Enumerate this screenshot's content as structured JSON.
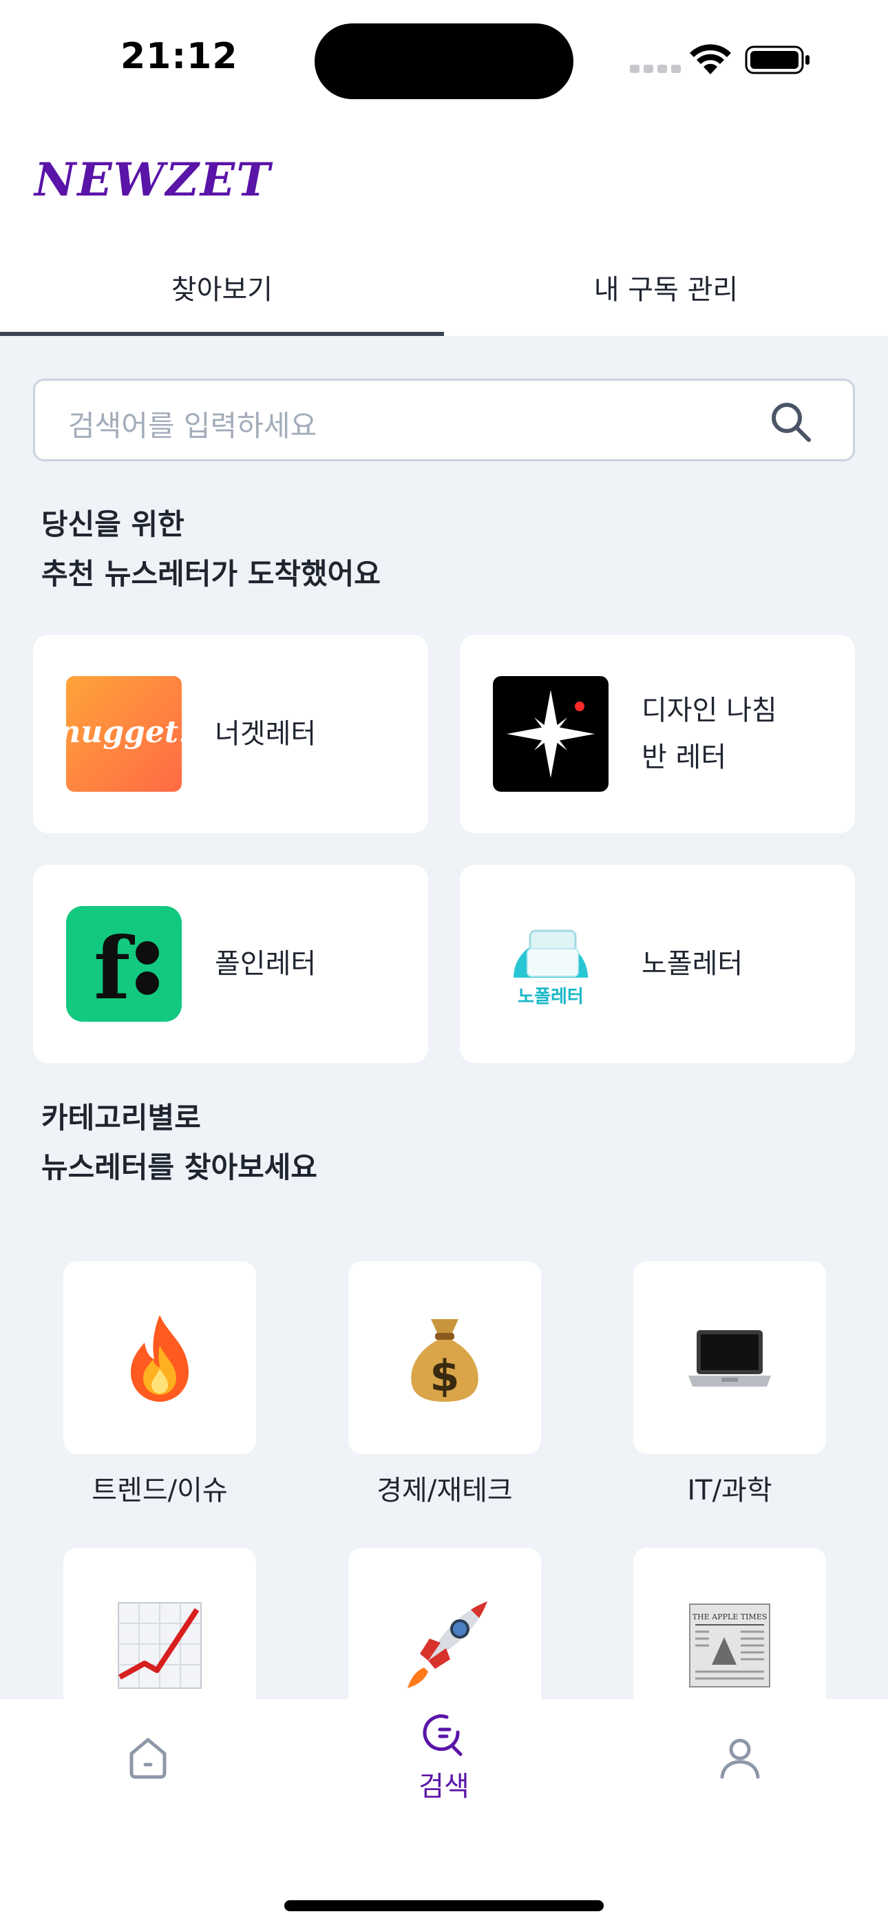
{
  "status_bar": {
    "time": "21:12"
  },
  "header": {
    "logo": "NEWZET"
  },
  "tabs": [
    {
      "label": "찾아보기",
      "active": true
    },
    {
      "label": "내 구독 관리",
      "active": false
    }
  ],
  "search": {
    "placeholder": "검색어를 입력하세요"
  },
  "recommend": {
    "title_line1": "당신을 위한",
    "title_line2": "추천 뉴스레터가 도착했어요",
    "cards": [
      {
        "name": "너겟레터",
        "logo_text": "nugget.",
        "icon": "nugget-logo"
      },
      {
        "name_line1": "디자인 나침",
        "name_line2": "반 레터",
        "icon": "compass-star-logo"
      },
      {
        "name": "폴인레터",
        "logo_text": "f:",
        "icon": "folin-logo"
      },
      {
        "name": "노폴레터",
        "logo_text": "노폴레터",
        "icon": "nopol-logo"
      }
    ]
  },
  "categories": {
    "title_line1": "카테고리별로",
    "title_line2": "뉴스레터를 찾아보세요",
    "items": [
      {
        "label": "트렌드/이슈",
        "icon": "fire-icon"
      },
      {
        "label": "경제/재테크",
        "icon": "money-bag-icon"
      },
      {
        "label": "IT/과학",
        "icon": "laptop-icon"
      },
      {
        "label": "",
        "icon": "chart-up-icon"
      },
      {
        "label": "",
        "icon": "rocket-icon"
      },
      {
        "label": "",
        "icon": "newspaper-icon",
        "emoji_text": "THE APPLE TIMES"
      }
    ]
  },
  "bottom_nav": {
    "items": [
      {
        "label": "",
        "icon": "home-icon"
      },
      {
        "label": "검색",
        "icon": "search-nav-icon",
        "active": true
      },
      {
        "label": "",
        "icon": "profile-icon"
      }
    ]
  },
  "colors": {
    "brand": "#5a14a8",
    "background": "#eff2f7",
    "accent_green": "#12c97f"
  }
}
